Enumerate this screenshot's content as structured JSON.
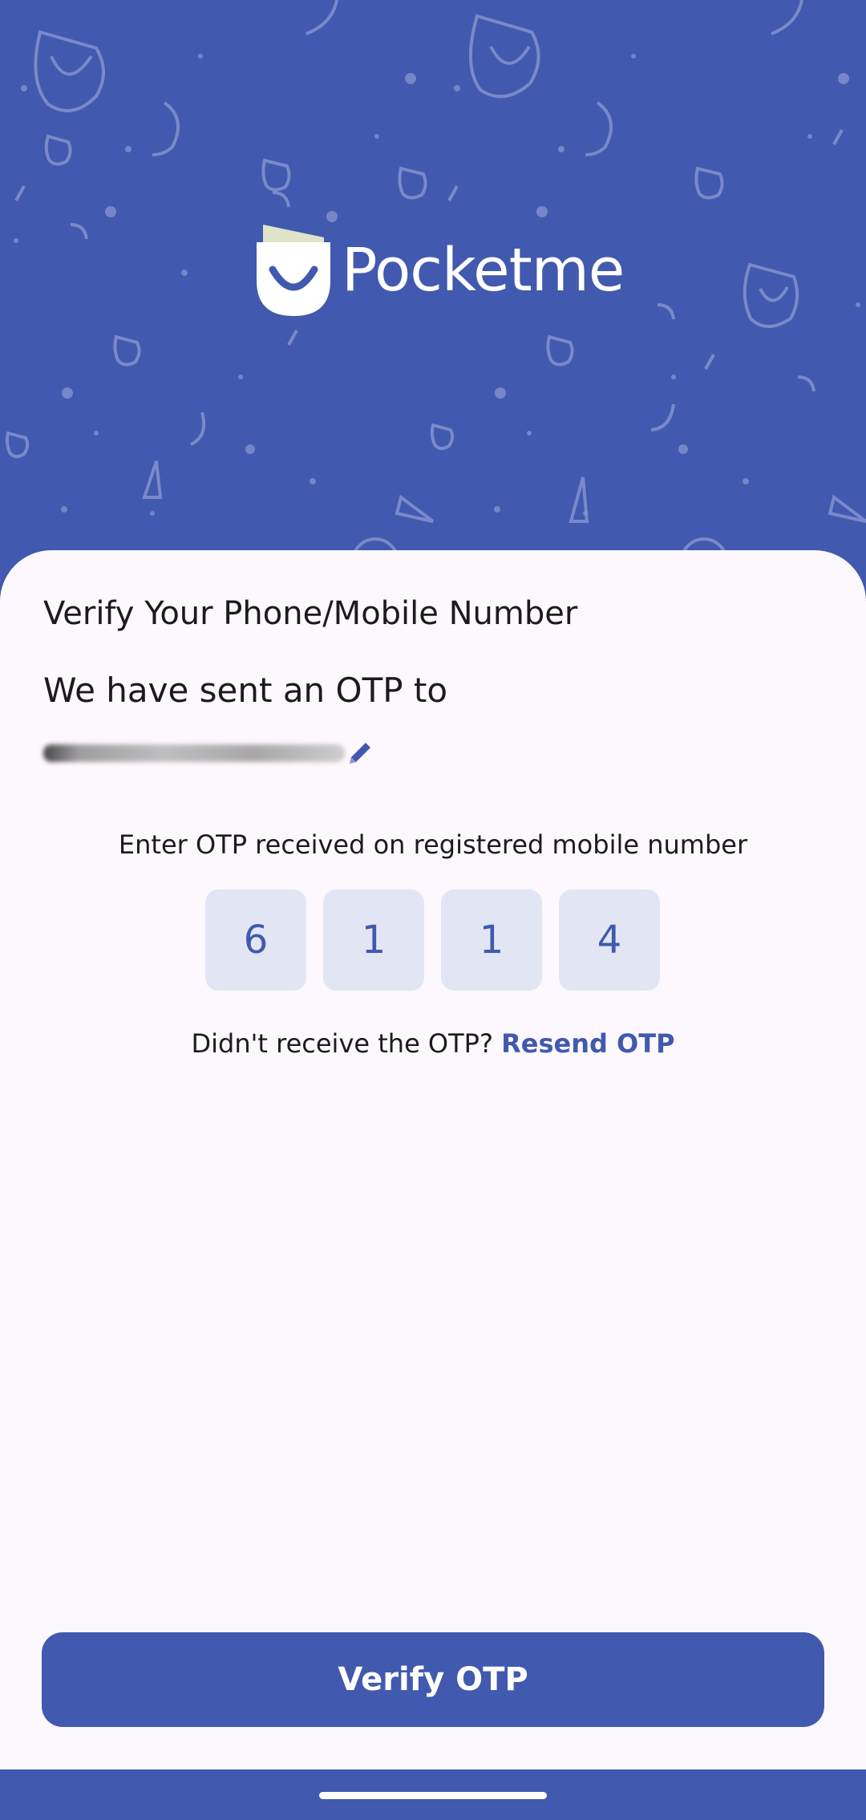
{
  "brand": {
    "name": "Pocketme",
    "logo_icon": "pocket-smile-icon",
    "background_color": "#4159ae"
  },
  "verify": {
    "title": "Verify Your Phone/Mobile Number",
    "sent_label": "We have sent an OTP to",
    "edit_icon": "pencil-icon",
    "instruction": "Enter OTP received on registered mobile number",
    "otp_digits": [
      "6",
      "1",
      "1",
      "4"
    ],
    "resend_prompt": "Didn't receive the OTP?",
    "resend_link": "Resend OTP",
    "button_label": "Verify OTP"
  },
  "colors": {
    "accent": "#4159ae",
    "otp_box": "#e2e6f4",
    "card_bg": "#fdf8fd",
    "text": "#1b1b1f"
  }
}
